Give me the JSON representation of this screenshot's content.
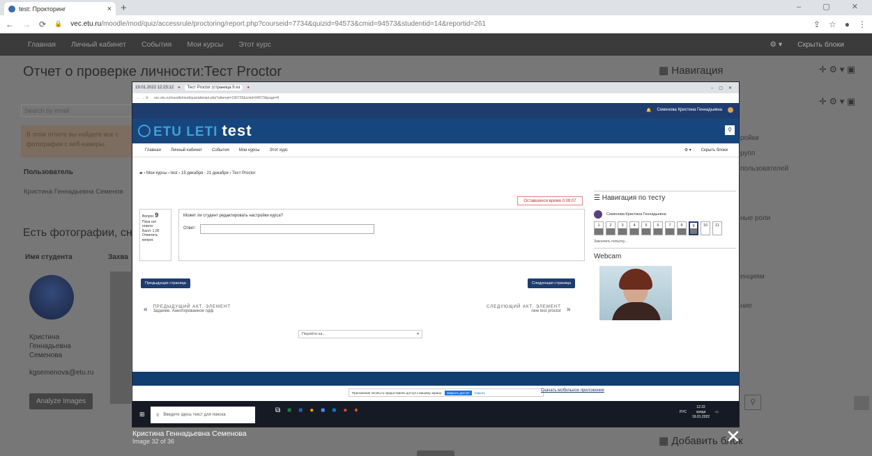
{
  "browser": {
    "tab_title": "test: Прокторинг",
    "tab_close": "×",
    "new_tab": "+",
    "window_controls": "‒ ▢ ✕",
    "url_host": "vec.etu.ru",
    "url_path": "/moodle/mod/quiz/accessrule/proctoring/report.php?courseid=7734&quizid=94573&cmid=94573&studentid=14&reportid=261"
  },
  "bg_nav": {
    "items": [
      "Главная",
      "Личный кабинет",
      "События",
      "Мои курсы",
      "Этот курс"
    ],
    "hide_blocks": "Скрыть блоки"
  },
  "bg_page": {
    "title": "Отчет о проверке личности:Тест Proctor",
    "search_placeholder": "Search by email",
    "info_text_1": "В этом отчете вы найдете все с",
    "info_text_2": "фотографии с веб-камеры.",
    "user_header": "Пользователь",
    "user_name": "Кристина Геннадьевна Семенов",
    "photos_heading": "Есть фотографии, сн",
    "col_student": "Имя студента",
    "col_capture": "Захва",
    "student_name_lines": [
      "Кристина",
      "Геннадьевна",
      "Семенова"
    ],
    "student_email": "kgsemenova@etu.ru",
    "analyze_button": "Analyze Images",
    "right_nav_title": "Навигация",
    "right_items": [
      "ройки",
      "рупп",
      "пользователей",
      "ные роли",
      "енциям",
      "ние"
    ],
    "add_block": "Добавить блок"
  },
  "popup": {
    "timestamp": "19.01.2022 12:23:12",
    "tab1": "Тест Proctor (страница 9 из",
    "url": "vec.etu.ru/moodle/mod/quiz/attempt.php?attempt=196725&cmid=94573&page=8",
    "user": "Семенова Кристина Геннадьевна",
    "logo": "ETU LETI",
    "logo_suffix": "test",
    "menu": [
      "Главная",
      "Личный кабинет",
      "События",
      "Мои курсы",
      "Этот курс"
    ],
    "hide_blocks": "Скрыть блоки",
    "breadcrumb": "Мои курсы › test › 15 декабря - 21 декабря › Тест Proctor",
    "timer": "Оставшееся время 0:09:07",
    "q_label": "Вопрос",
    "q_number": "9",
    "q_info": [
      "Пока нет",
      "ответа",
      "Балл: 1,00",
      "Отметить",
      "вопрос"
    ],
    "q_text": "Может ли студент редактировать настройки курса?",
    "answer_label": "Ответ:",
    "prev_page": "Предыдущая страница",
    "next_page": "Следующая страница",
    "prev_activity_caption": "ПРЕДЫДУЩИЙ АКТ. ЭЛЕМЕНТ",
    "prev_activity_name": "Задание. Аннотированное пдф",
    "next_activity_caption": "СЛЕДУЮЩИЙ АКТ. ЭЛЕМЕНТ",
    "next_activity_name": "new test proctor",
    "jump_select": "Перейти на...",
    "nav_title": "Навигация по тесту",
    "nav_user": "Семенова Кристина Геннадьевна",
    "nav_numbers": [
      "1",
      "2",
      "3",
      "4",
      "5",
      "6",
      "7",
      "8",
      "9",
      "10",
      "11"
    ],
    "nav_current": "9",
    "finish_attempt": "Закончить попытку...",
    "webcam_title": "Webcam",
    "share_notice": "Приложение vecetu.ru предоставлен доступ к вашему экрану.",
    "share_stop": "Закрыть доступ",
    "share_hide": "Скрыть",
    "mobile_app": "Скачать мобильное приложение",
    "taskbar_search": "Введите здесь текст для поиска",
    "tray_lang": "РУС",
    "tray_time": "12:22",
    "tray_day": "среда",
    "tray_date": "19.01.2022"
  },
  "viewer": {
    "caption_name": "Кристина Геннадьевна Семенова",
    "caption_count": "Image 32 of 36",
    "close": "✕"
  },
  "colors": {
    "brand_blue": "#17467e",
    "overlay_gray": "#777777",
    "primary_button": "#1f3c6e"
  }
}
